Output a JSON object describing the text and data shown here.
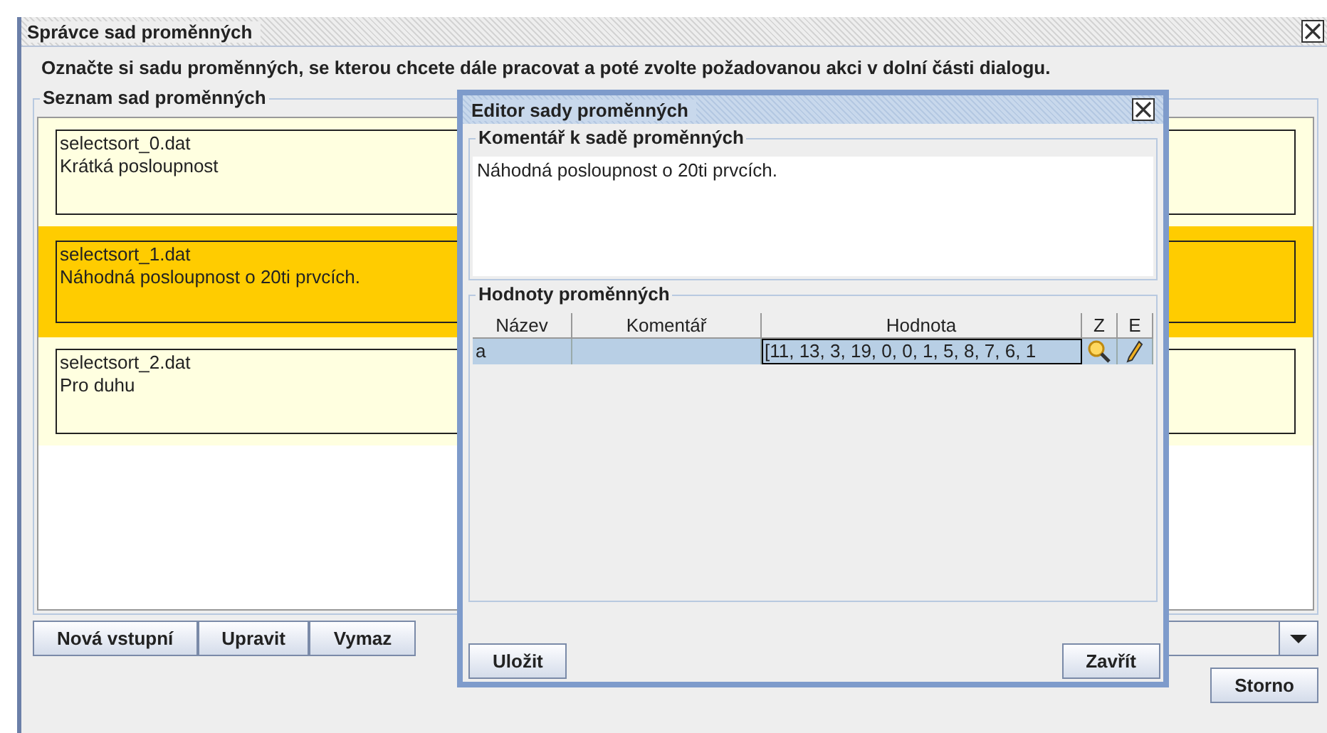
{
  "window": {
    "title": "Správce sad proměnných",
    "instruction": "Označte si sadu proměnných, se kterou chcete dále pracovat a poté zvolte požadovanou akci v dolní části dialogu.",
    "list": {
      "title": "Seznam sad proměnných",
      "items": [
        {
          "file": "selectsort_0.dat",
          "comment": "Krátká posloupnost",
          "selected": false
        },
        {
          "file": "selectsort_1.dat",
          "comment": "Náhodná posloupnost o 20ti prvcích.",
          "selected": true
        },
        {
          "file": "selectsort_2.dat",
          "comment": "Pro duhu",
          "selected": false
        }
      ]
    },
    "toolbar": {
      "buttons": [
        "Nová vstupní",
        "Upravit",
        "Vymaz"
      ]
    },
    "buttons": [
      "Storno"
    ]
  },
  "dialog": {
    "title": "Editor sady proměnných",
    "comment_group": {
      "title": "Komentář k sadě proměnných",
      "value": "Náhodná posloupnost o 20ti prvcích."
    },
    "values_group": {
      "title": "Hodnoty proměnných",
      "columns": [
        "Název",
        "Komentář",
        "Hodnota",
        "Z",
        "E"
      ],
      "rows": [
        {
          "name": "a",
          "value": "[11, 13, 3, 19, 0, 0, 1, 5, 8, 7, 6, 1",
          "selected": true
        }
      ]
    },
    "buttons": [
      "Uložit",
      "Zavřít"
    ]
  }
}
